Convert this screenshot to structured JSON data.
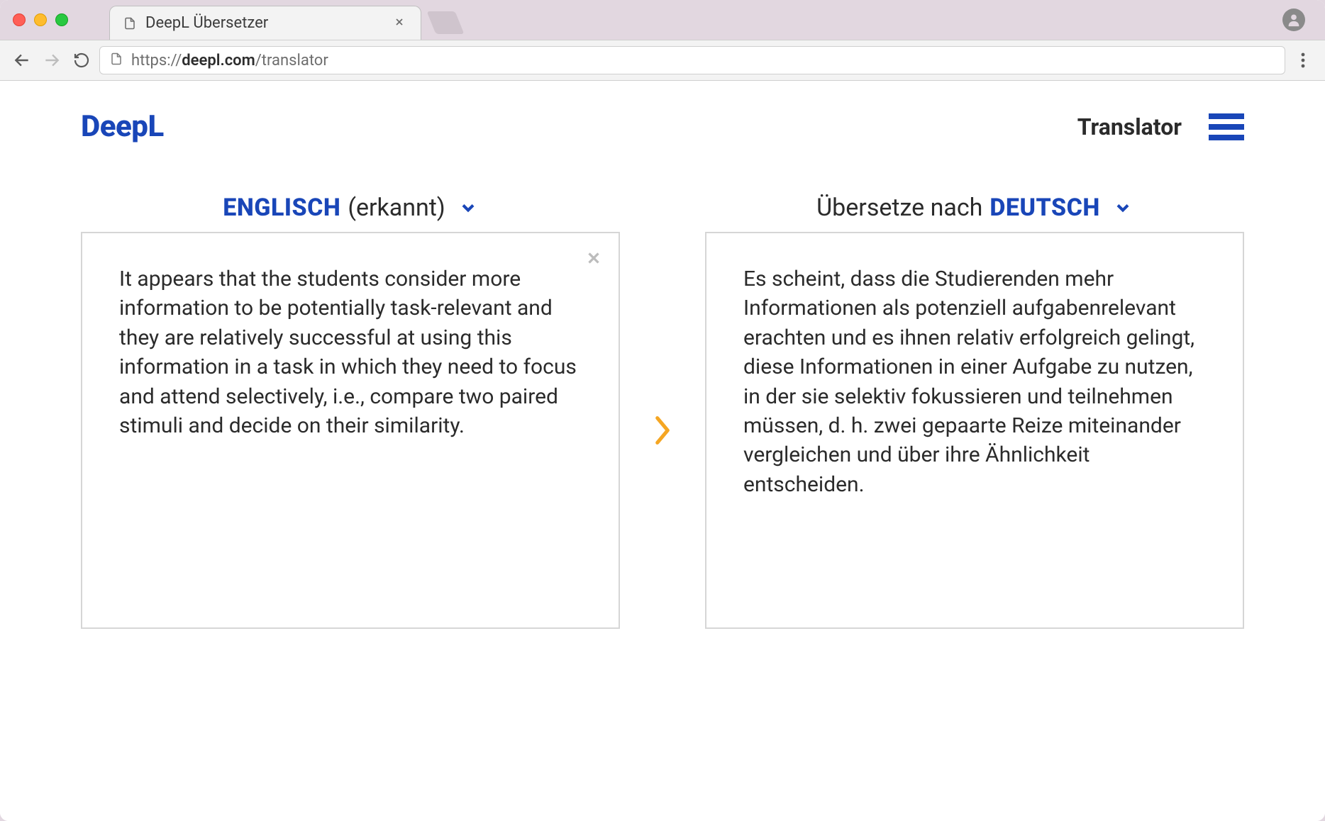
{
  "browser": {
    "tab_title": "DeepL Übersetzer",
    "url_proto": "https://",
    "url_host": "deepl.com",
    "url_path": "/translator"
  },
  "header": {
    "logo": "DeepL",
    "nav_label": "Translator"
  },
  "source": {
    "lang_label": "ENGLISCH",
    "detected_suffix": "(erkannt)",
    "text": "It appears that the students consider more information to be potentially task-relevant and they are relatively successful at using this information in a task in which they need to focus and attend selectively, i.e., compare two paired stimuli and decide on their similarity."
  },
  "target": {
    "prefix": "Übersetze nach",
    "lang_label": "DEUTSCH",
    "text": "Es scheint, dass die Studierenden mehr Informationen als potenziell aufgabenrelevant erachten und es ihnen relativ erfolgreich gelingt, diese Informationen in einer Aufgabe zu nutzen, in der sie selektiv fokussieren und teilnehmen müssen, d. h. zwei gepaarte Reize miteinander vergleichen und über ihre Ähnlichkeit entscheiden."
  }
}
